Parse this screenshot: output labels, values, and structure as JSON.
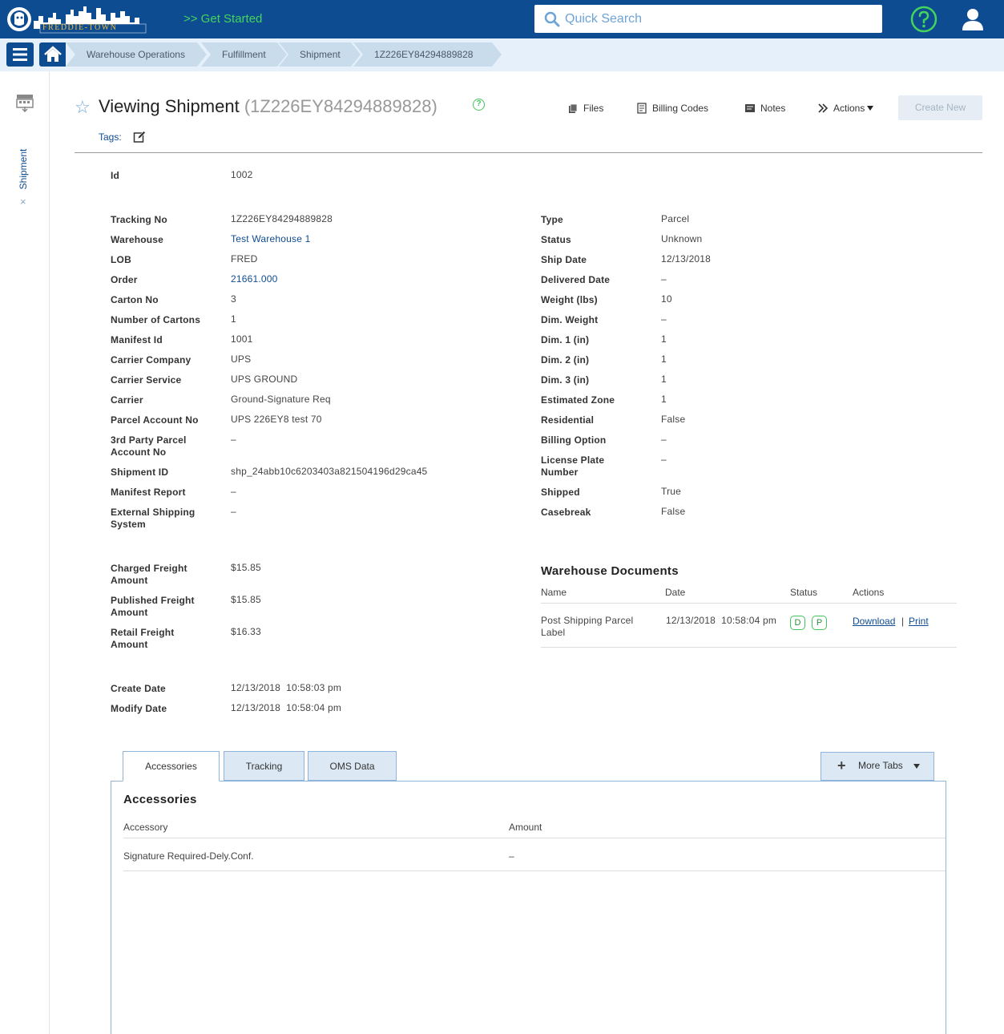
{
  "app": {
    "logo_text": "FREDDIE-TOWN",
    "get_started": ">> Get Started",
    "search_placeholder": "Quick Search"
  },
  "breadcrumbs": [
    "Warehouse Operations",
    "Fulfillment",
    "Shipment",
    "1Z226EY84294889828"
  ],
  "sidebar": {
    "tab_label": "Shipment",
    "close_label": "×"
  },
  "header": {
    "title": "Viewing Shipment",
    "subtitle": "(1Z226EY84294889828)",
    "help": "?",
    "tags_label": "Tags:",
    "toolbar": {
      "files": "Files",
      "billing_codes": "Billing Codes",
      "notes": "Notes",
      "actions": "Actions",
      "create_new": "Create New"
    }
  },
  "fields": {
    "id": {
      "label": "Id",
      "value": "1002"
    },
    "left": [
      {
        "label": "Tracking No",
        "value": "1Z226EY84294889828"
      },
      {
        "label": "Warehouse",
        "value": "Test Warehouse 1"
      },
      {
        "label": "LOB",
        "value": "FRED"
      },
      {
        "label": "Order",
        "value": "21661.000"
      },
      {
        "label": "Carton No",
        "value": "3"
      },
      {
        "label": "Number of Cartons",
        "value": "1"
      },
      {
        "label": "Manifest Id",
        "value": "1001"
      },
      {
        "label": "Carrier Company",
        "value": "UPS"
      },
      {
        "label": "Carrier Service",
        "value": "UPS GROUND"
      },
      {
        "label": "Carrier",
        "value": "Ground-Signature Req"
      },
      {
        "label": "Parcel Account No",
        "value": "UPS 226EY8 test 70"
      },
      {
        "label": "3rd Party Parcel Account No",
        "value": "–"
      },
      {
        "label": "Shipment ID",
        "value": "shp_24abb10c6203403a821504196d29ca45"
      },
      {
        "label": "Manifest Report",
        "value": "–"
      },
      {
        "label": "External Shipping System",
        "value": "–"
      }
    ],
    "right": [
      {
        "label": "Type",
        "value": "Parcel"
      },
      {
        "label": "Status",
        "value": "Unknown"
      },
      {
        "label": "Ship Date",
        "value": "12/13/2018"
      },
      {
        "label": "Delivered Date",
        "value": "–"
      },
      {
        "label": "Weight (lbs)",
        "value": "10"
      },
      {
        "label": "Dim. Weight",
        "value": "–"
      },
      {
        "label": "Dim. 1 (in)",
        "value": "1"
      },
      {
        "label": "Dim. 2 (in)",
        "value": "1"
      },
      {
        "label": "Dim. 3 (in)",
        "value": "1"
      },
      {
        "label": "Estimated Zone",
        "value": "1"
      },
      {
        "label": "Residential",
        "value": "False"
      },
      {
        "label": "Billing Option",
        "value": "–"
      },
      {
        "label": "License Plate Number",
        "value": "–"
      },
      {
        "label": "Shipped",
        "value": "True"
      },
      {
        "label": "Casebreak",
        "value": "False"
      }
    ],
    "freight": [
      {
        "label": "Charged Freight Amount",
        "value": "$15.85"
      },
      {
        "label": "Published Freight Amount",
        "value": "$15.85"
      },
      {
        "label": "Retail Freight Amount",
        "value": "$16.33"
      }
    ],
    "dates": [
      {
        "label": "Create Date",
        "value": "12/13/2018  10:58:03 pm"
      },
      {
        "label": "Modify Date",
        "value": "12/13/2018  10:58:04 pm"
      }
    ]
  },
  "warehouse_documents": {
    "title": "Warehouse Documents",
    "columns": [
      "Name",
      "Date",
      "Status",
      "Actions"
    ],
    "rows": [
      {
        "name": "Post Shipping Parcel Label",
        "date": "12/13/2018  10:58:04 pm",
        "status_badges": [
          "D",
          "P"
        ],
        "actions": [
          "Download",
          "Print"
        ],
        "separator": "|"
      }
    ]
  },
  "tabs": {
    "items": [
      "Accessories",
      "Tracking",
      "OMS Data"
    ],
    "active": "Accessories",
    "more_tabs": "More Tabs"
  },
  "accessories": {
    "title": "Accessories",
    "columns": [
      "Accessory",
      "Amount"
    ],
    "rows": [
      {
        "accessory": "Signature Required-Dely.Conf.",
        "amount": "–"
      }
    ]
  },
  "colors": {
    "brand": "#0e4c92",
    "accent_green": "#44d45b",
    "breadcrumb_bg": "#c9dceb",
    "tab_bg": "#dce9f5"
  }
}
